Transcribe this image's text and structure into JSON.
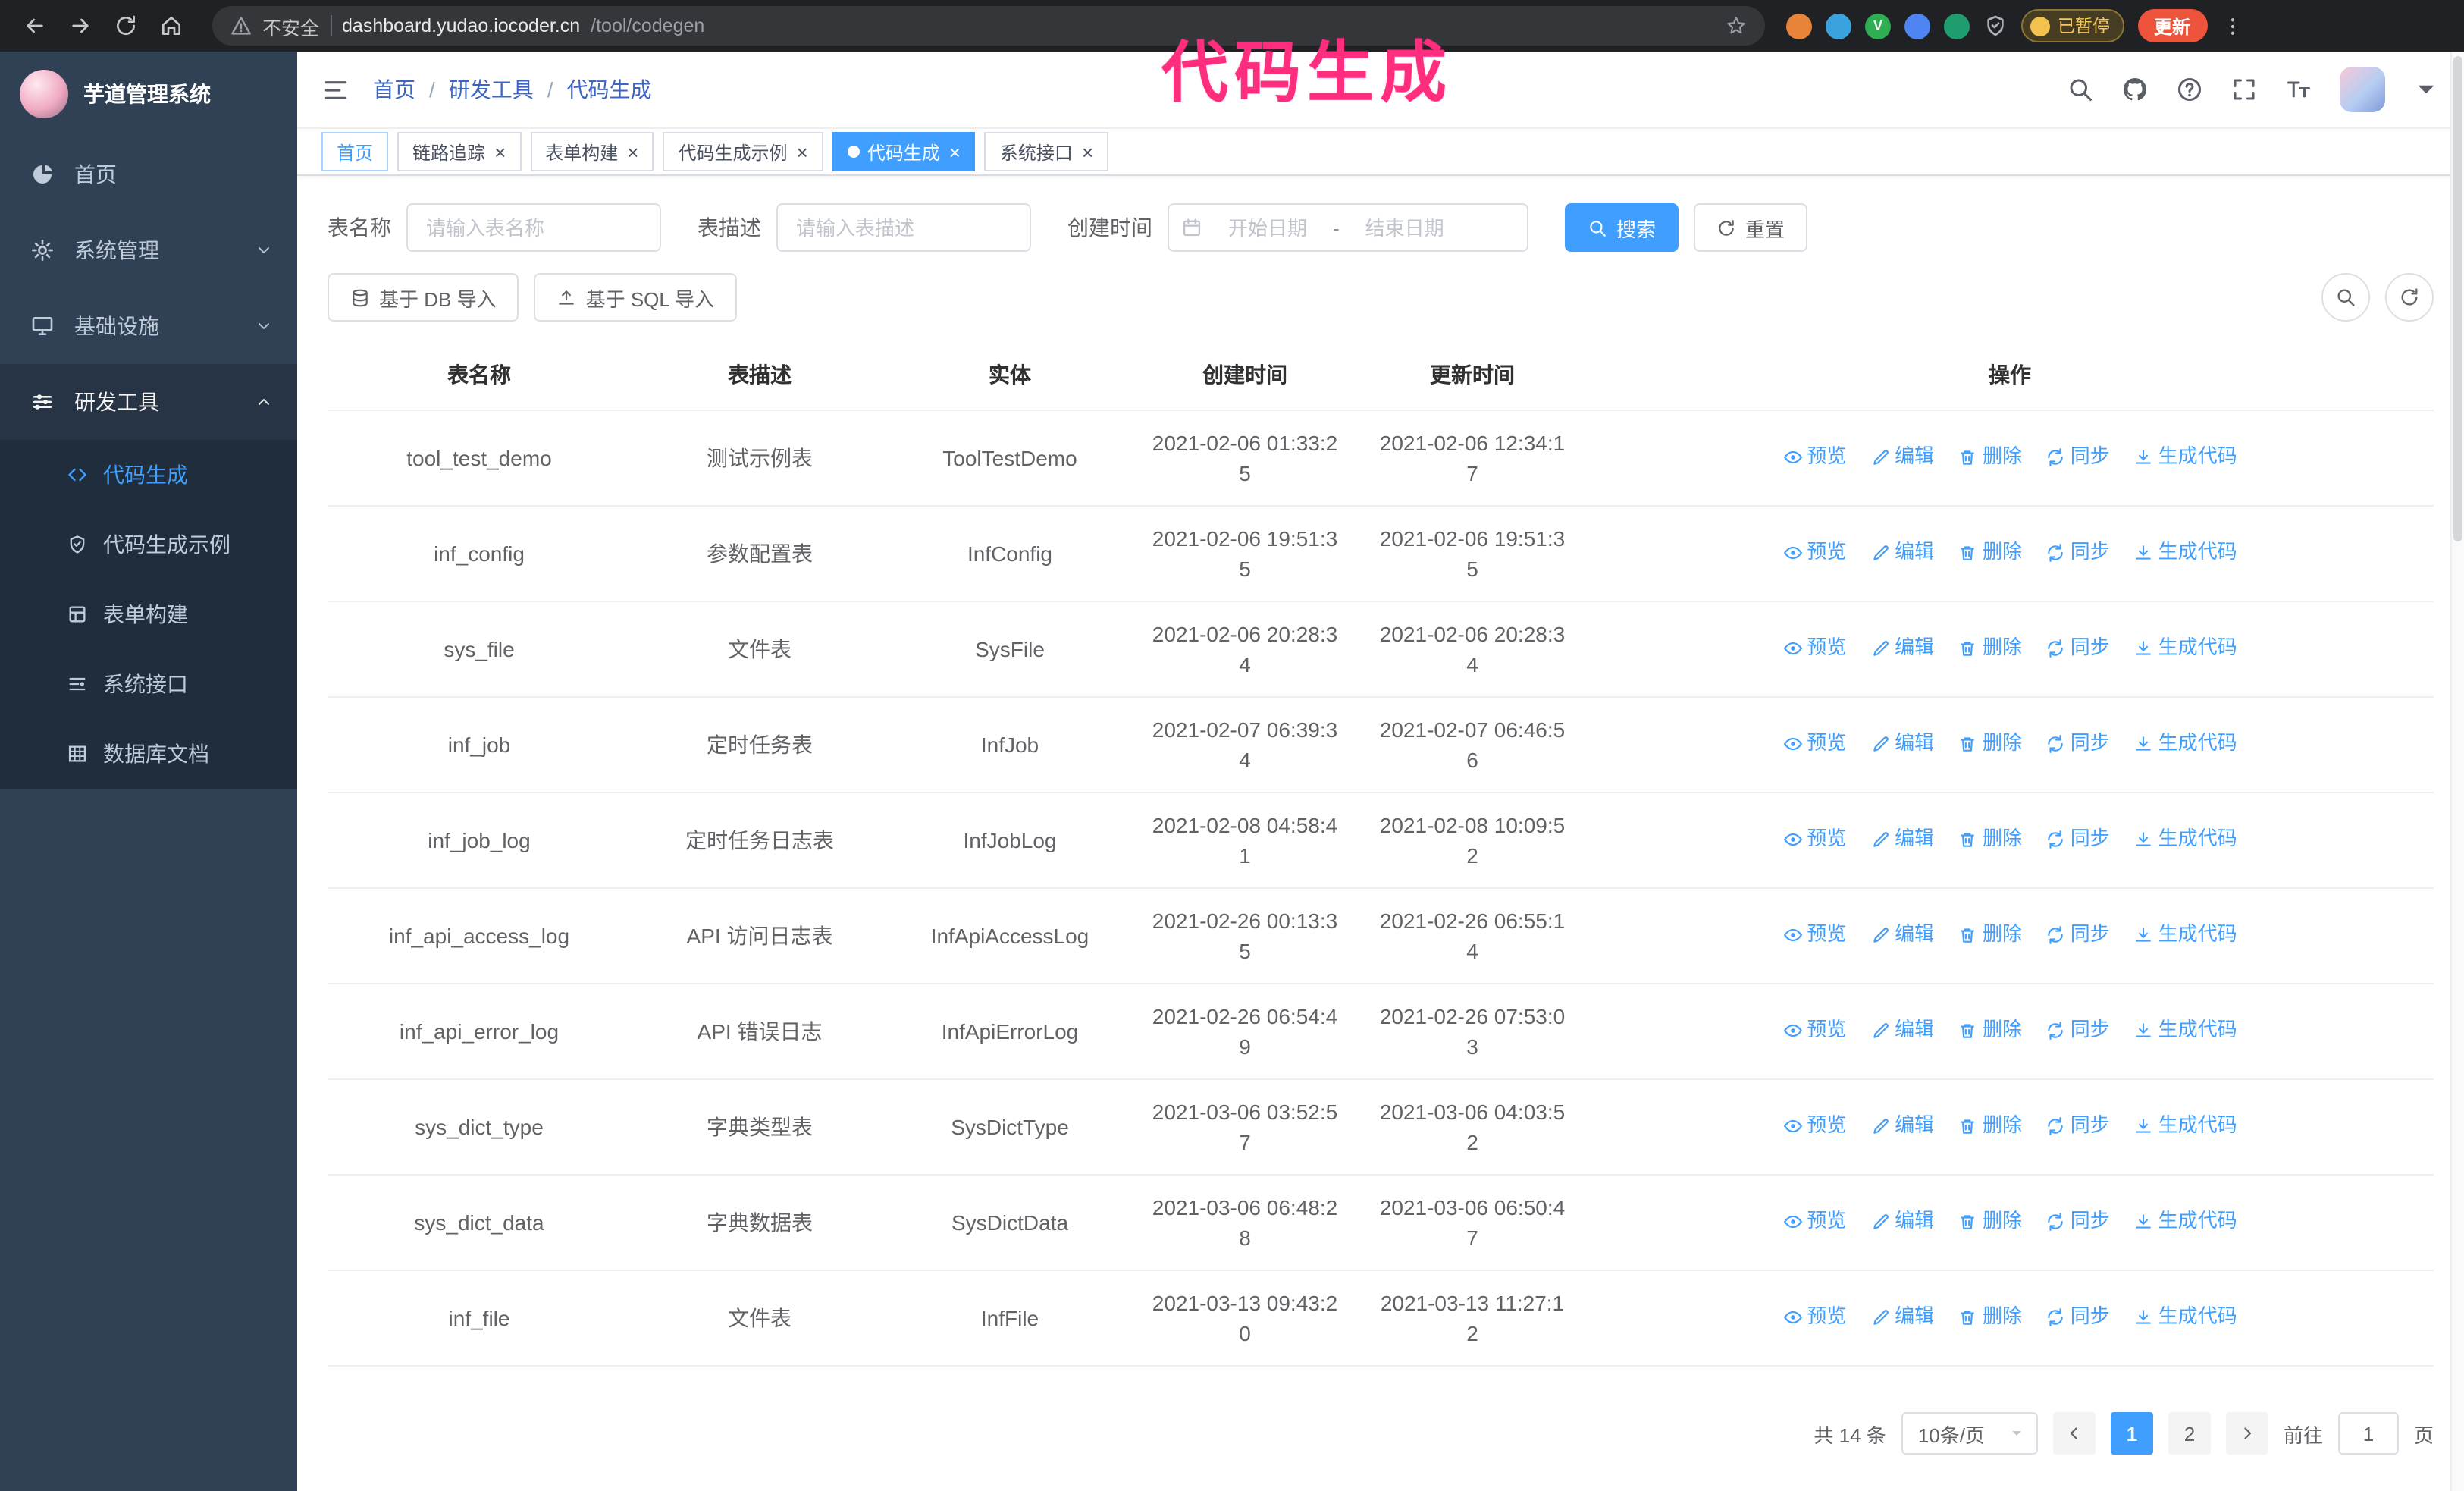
{
  "annotation": {
    "text": "代码生成"
  },
  "browser": {
    "security_label": "不安全",
    "url_host": "dashboard.yudao.iocoder.cn",
    "url_path": "/tool/codegen",
    "paused_badge": "已暂停",
    "update_button": "更新"
  },
  "icons": {
    "close": "×",
    "breadcrumb_separator": "/"
  },
  "sidebar": {
    "title": "芋道管理系统",
    "items": [
      {
        "label": "首页"
      },
      {
        "label": "系统管理"
      },
      {
        "label": "基础设施"
      },
      {
        "label": "研发工具"
      }
    ],
    "subitems": [
      {
        "label": "代码生成"
      },
      {
        "label": "代码生成示例"
      },
      {
        "label": "表单构建"
      },
      {
        "label": "系统接口"
      },
      {
        "label": "数据库文档"
      }
    ]
  },
  "header": {
    "breadcrumb": [
      "首页",
      "研发工具",
      "代码生成"
    ]
  },
  "tabs": [
    {
      "label": "首页"
    },
    {
      "label": "链路追踪"
    },
    {
      "label": "表单构建"
    },
    {
      "label": "代码生成示例"
    },
    {
      "label": "代码生成"
    },
    {
      "label": "系统接口"
    }
  ],
  "filters": {
    "table_name_label": "表名称",
    "table_name_placeholder": "请输入表名称",
    "table_desc_label": "表描述",
    "table_desc_placeholder": "请输入表描述",
    "create_time_label": "创建时间",
    "date_start_placeholder": "开始日期",
    "date_separator": "-",
    "date_end_placeholder": "结束日期",
    "search_button": "搜索",
    "reset_button": "重置"
  },
  "toolbar": {
    "import_db": "基于 DB 导入",
    "import_sql": "基于 SQL 导入"
  },
  "table": {
    "columns": [
      "表名称",
      "表描述",
      "实体",
      "创建时间",
      "更新时间",
      "操作"
    ],
    "actions": [
      "预览",
      "编辑",
      "删除",
      "同步",
      "生成代码"
    ],
    "rows": [
      {
        "name": "tool_test_demo",
        "desc": "测试示例表",
        "entity": "ToolTestDemo",
        "created": "2021-02-06 01:33:25",
        "updated": "2021-02-06 12:34:17"
      },
      {
        "name": "inf_config",
        "desc": "参数配置表",
        "entity": "InfConfig",
        "created": "2021-02-06 19:51:35",
        "updated": "2021-02-06 19:51:35"
      },
      {
        "name": "sys_file",
        "desc": "文件表",
        "entity": "SysFile",
        "created": "2021-02-06 20:28:34",
        "updated": "2021-02-06 20:28:34"
      },
      {
        "name": "inf_job",
        "desc": "定时任务表",
        "entity": "InfJob",
        "created": "2021-02-07 06:39:34",
        "updated": "2021-02-07 06:46:56"
      },
      {
        "name": "inf_job_log",
        "desc": "定时任务日志表",
        "entity": "InfJobLog",
        "created": "2021-02-08 04:58:41",
        "updated": "2021-02-08 10:09:52"
      },
      {
        "name": "inf_api_access_log",
        "desc": "API 访问日志表",
        "entity": "InfApiAccessLog",
        "created": "2021-02-26 00:13:35",
        "updated": "2021-02-26 06:55:14"
      },
      {
        "name": "inf_api_error_log",
        "desc": "API 错误日志",
        "entity": "InfApiErrorLog",
        "created": "2021-02-26 06:54:49",
        "updated": "2021-02-26 07:53:03"
      },
      {
        "name": "sys_dict_type",
        "desc": "字典类型表",
        "entity": "SysDictType",
        "created": "2021-03-06 03:52:57",
        "updated": "2021-03-06 04:03:52"
      },
      {
        "name": "sys_dict_data",
        "desc": "字典数据表",
        "entity": "SysDictData",
        "created": "2021-03-06 06:48:28",
        "updated": "2021-03-06 06:50:47"
      },
      {
        "name": "inf_file",
        "desc": "文件表",
        "entity": "InfFile",
        "created": "2021-03-13 09:43:20",
        "updated": "2021-03-13 11:27:12"
      }
    ]
  },
  "pagination": {
    "total": "共 14 条",
    "page_size": "10条/页",
    "pages": [
      "1",
      "2"
    ],
    "goto_label": "前往",
    "goto_value": "1",
    "goto_suffix": "页"
  }
}
